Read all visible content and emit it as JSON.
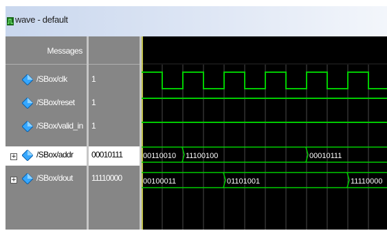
{
  "window": {
    "title": "wave - default"
  },
  "columns": {
    "messages_header": "Messages"
  },
  "signals": [
    {
      "name": "/SBox/clk",
      "value": "1",
      "kind": "bit",
      "icon": "signal-diamond-icon"
    },
    {
      "name": "/SBox/reset",
      "value": "1",
      "kind": "bit",
      "icon": "signal-diamond-icon"
    },
    {
      "name": "/SBox/valid_in",
      "value": "1",
      "kind": "bit",
      "icon": "signal-diamond-icon"
    },
    {
      "name": "/SBox/addr",
      "value": "00010111",
      "kind": "bus",
      "expandable": true,
      "selected": true,
      "icon": "signal-diamond-icon",
      "segments": [
        "00110010",
        "11100100",
        "00010111"
      ]
    },
    {
      "name": "/SBox/dout",
      "value": "11110000",
      "kind": "bus",
      "expandable": true,
      "selected": false,
      "icon": "signal-diamond-icon",
      "segments": [
        "00100011",
        "01101001",
        "11110000"
      ]
    }
  ],
  "colors": {
    "wave": "#00cc00",
    "cursor": "#ffff66",
    "grid": "#4a4a4a",
    "background": "#000000",
    "pane": "#868686"
  }
}
